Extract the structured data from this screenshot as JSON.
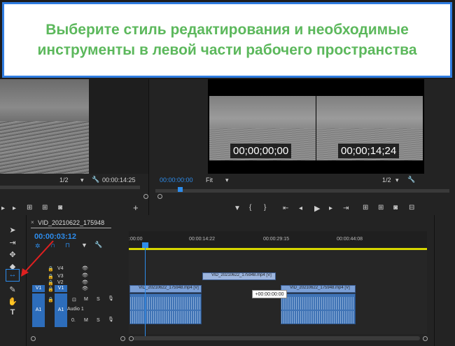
{
  "banner": {
    "text": "Выберите стиль редактирования и необходимые инструменты в левой части рабочего пространства"
  },
  "source_monitor": {
    "zoom": "1/2",
    "timecode": "00:00:14:25"
  },
  "program_monitor": {
    "timecode": "00:00:00:00",
    "fit": "Fit",
    "zoom": "1/2",
    "overlay_tc_left": "00;00;00;00",
    "overlay_tc_right": "00;00;14;24"
  },
  "timeline": {
    "tab_label": "VID_20210622_175948",
    "current_tc": "00:00:03:12",
    "ruler_labels": [
      ":00:00",
      "00:00:14:22",
      "00:00:29:15",
      "00:00:44:08"
    ],
    "tracks": {
      "v4": "V4",
      "v3": "V3",
      "v2": "V2",
      "v1": "V1",
      "a1": "A1",
      "audio1": "Audio 1",
      "src_v1": "V1",
      "src_a1": "A1",
      "m": "M",
      "s": "S",
      "o": "0."
    },
    "clips": {
      "v2_clip": "VID_20210622_175948.mp4 [V]",
      "v1_clip_left": "VID_20210622_175948.mp4 [V]",
      "v1_clip_right": "VID_20210622_175948.mp4 [V]"
    },
    "tooltip": "+00:00:00:00"
  },
  "colors": {
    "accent": "#2d8ceb",
    "banner_border": "#2f7de1",
    "banner_text": "#5cb85c",
    "work_area": "#d6d600",
    "arrow": "#e02020"
  }
}
